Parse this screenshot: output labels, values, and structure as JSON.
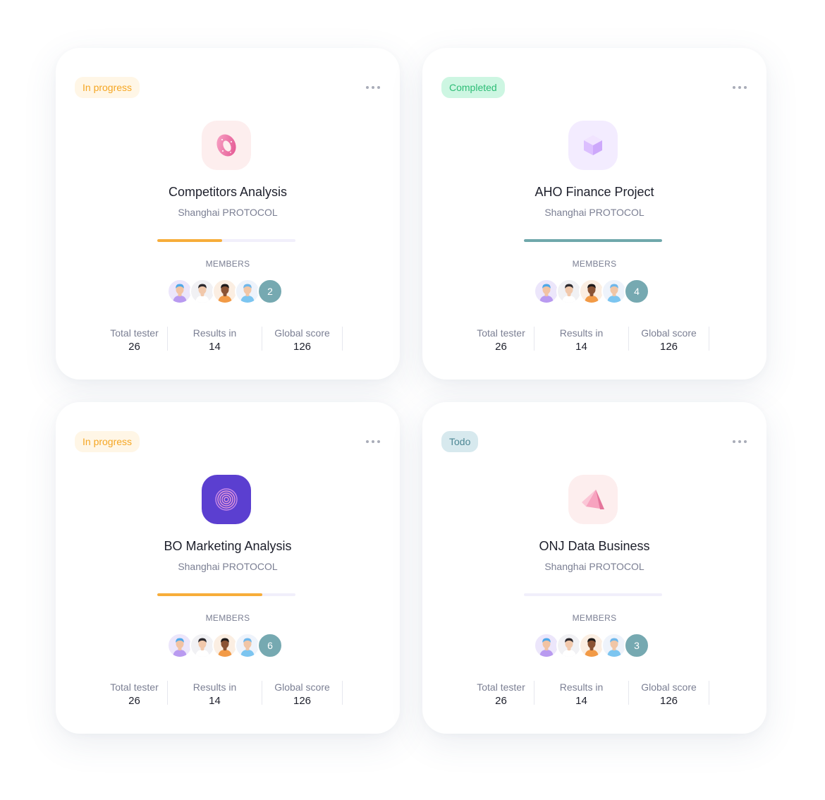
{
  "members_label": "MEMBERS",
  "cards": [
    {
      "status": "In progress",
      "status_kind": "progress",
      "icon": "donut-icon",
      "title": "Competitors Analysis",
      "subtitle": "Shanghai PROTOCOL",
      "progress": 0.47,
      "progress_color": "#f7ad3a",
      "extra_members": "2",
      "stats": [
        {
          "label": "Total tester",
          "value": "26"
        },
        {
          "label": "Results in",
          "value": "14"
        },
        {
          "label": "Global score",
          "value": "126"
        }
      ]
    },
    {
      "status": "Completed",
      "status_kind": "completed",
      "icon": "crystal-cube-icon",
      "title": "AHO Finance Project",
      "subtitle": "Shanghai PROTOCOL",
      "progress": 1.0,
      "progress_color": "#6fa8ab",
      "extra_members": "4",
      "stats": [
        {
          "label": "Total tester",
          "value": "26"
        },
        {
          "label": "Results in",
          "value": "14"
        },
        {
          "label": "Global score",
          "value": "126"
        }
      ]
    },
    {
      "status": "In progress",
      "status_kind": "progress",
      "icon": "fingerprint-icon",
      "title": "BO Marketing Analysis",
      "subtitle": "Shanghai PROTOCOL",
      "progress": 0.76,
      "progress_color": "#f7ad3a",
      "extra_members": "6",
      "stats": [
        {
          "label": "Total tester",
          "value": "26"
        },
        {
          "label": "Results in",
          "value": "14"
        },
        {
          "label": "Global score",
          "value": "126"
        }
      ]
    },
    {
      "status": "Todo",
      "status_kind": "todo",
      "icon": "pyramid-icon",
      "title": "ONJ Data Business",
      "subtitle": "Shanghai PROTOCOL",
      "progress": 0.0,
      "progress_color": "#f1effb",
      "extra_members": "3",
      "stats": [
        {
          "label": "Total tester",
          "value": "26"
        },
        {
          "label": "Results in",
          "value": "14"
        },
        {
          "label": "Global score",
          "value": "126"
        }
      ]
    }
  ]
}
